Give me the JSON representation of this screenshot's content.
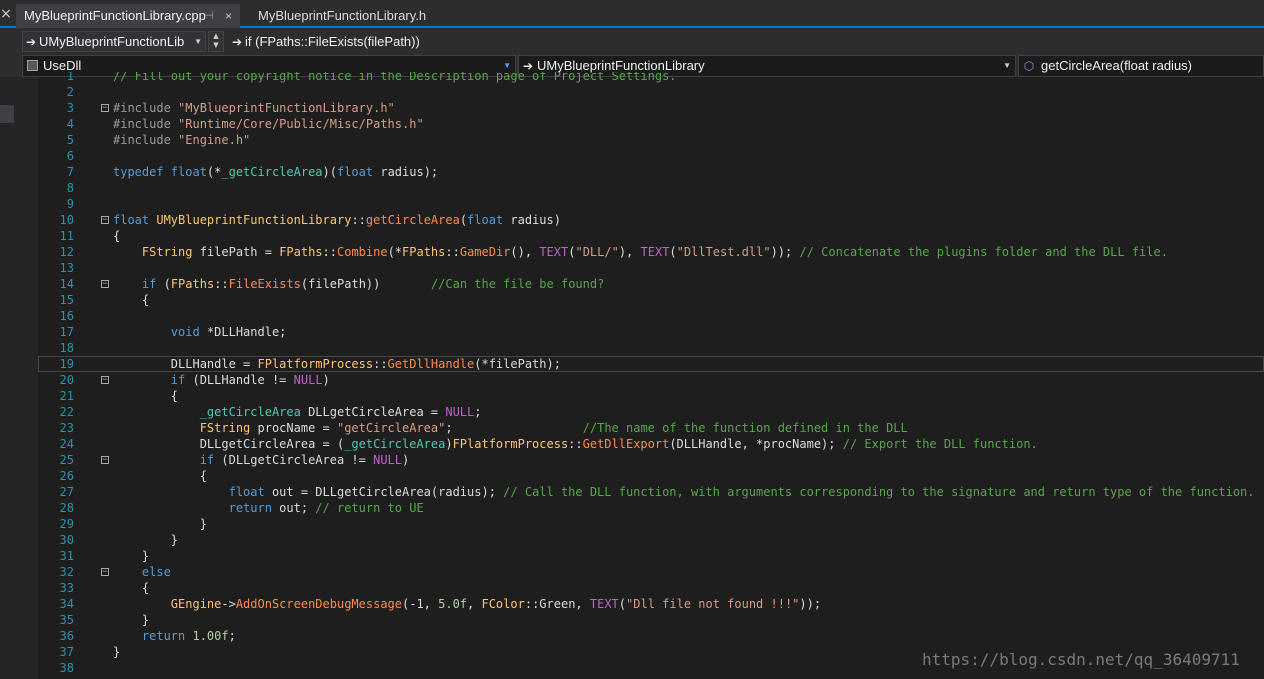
{
  "tabs": [
    {
      "label": "MyBlueprintFunctionLibrary.cpp",
      "active": true,
      "pin": "⊣",
      "close": "×"
    },
    {
      "label": "MyBlueprintFunctionLibrary.h",
      "active": false
    }
  ],
  "nav": {
    "class_combo": "UMyBlueprintFunctionLib",
    "scope_combo": "if (FPaths::FileExists(filePath))",
    "project_combo": "UseDll",
    "type_combo": "UMyBlueprintFunctionLibrary",
    "member_combo": "getCircleArea(float radius)"
  },
  "code": {
    "lines": [
      {
        "n": "1",
        "toks": [
          [
            "cm",
            "// Fill out your copyright notice in the Description page of Project Settings."
          ]
        ]
      },
      {
        "n": "2",
        "toks": []
      },
      {
        "n": "3",
        "fold": "⊟",
        "toks": [
          [
            "pp",
            "#include "
          ],
          [
            "st",
            "\"MyBlueprintFunctionLibrary.h\""
          ]
        ]
      },
      {
        "n": "4",
        "toks": [
          [
            "pp",
            "#include "
          ],
          [
            "st",
            "\"Runtime/Core/Public/Misc/Paths.h\""
          ]
        ]
      },
      {
        "n": "5",
        "toks": [
          [
            "pp",
            "#include "
          ],
          [
            "st",
            "\"Engine.h\""
          ]
        ]
      },
      {
        "n": "6",
        "toks": []
      },
      {
        "n": "7",
        "toks": [
          [
            "kw",
            "typedef "
          ],
          [
            "kw",
            "float"
          ],
          [
            "tx",
            "(*"
          ],
          [
            "ty",
            "_getCircleArea"
          ],
          [
            "tx",
            ")("
          ],
          [
            "kw",
            "float "
          ],
          [
            "tx",
            "radius);"
          ]
        ]
      },
      {
        "n": "8",
        "toks": []
      },
      {
        "n": "9",
        "toks": []
      },
      {
        "n": "10",
        "fold": "⊟",
        "toks": [
          [
            "kw",
            "float "
          ],
          [
            "cl",
            "UMyBlueprintFunctionLibrary"
          ],
          [
            "tx",
            "::"
          ],
          [
            "fn",
            "getCircleArea"
          ],
          [
            "tx",
            "("
          ],
          [
            "kw",
            "float "
          ],
          [
            "tx",
            "radius)"
          ]
        ]
      },
      {
        "n": "11",
        "toks": [
          [
            "tx",
            "{"
          ]
        ]
      },
      {
        "n": "12",
        "toks": [
          [
            "tx",
            "    "
          ],
          [
            "cl",
            "FString "
          ],
          [
            "tx",
            "filePath = "
          ],
          [
            "cl",
            "FPaths"
          ],
          [
            "tx",
            "::"
          ],
          [
            "fn",
            "Combine"
          ],
          [
            "tx",
            "(*"
          ],
          [
            "cl",
            "FPaths"
          ],
          [
            "tx",
            "::"
          ],
          [
            "fn",
            "GameDir"
          ],
          [
            "tx",
            "(), "
          ],
          [
            "mac",
            "TEXT"
          ],
          [
            "tx",
            "("
          ],
          [
            "st",
            "\"DLL/\""
          ],
          [
            "tx",
            "), "
          ],
          [
            "mac",
            "TEXT"
          ],
          [
            "tx",
            "("
          ],
          [
            "st",
            "\"DllTest.dll\""
          ],
          [
            "tx",
            ")); "
          ],
          [
            "cm",
            "// Concatenate the plugins folder and the DLL file."
          ]
        ]
      },
      {
        "n": "13",
        "toks": []
      },
      {
        "n": "14",
        "fold": "⊟",
        "toks": [
          [
            "tx",
            "    "
          ],
          [
            "kw",
            "if "
          ],
          [
            "tx",
            "("
          ],
          [
            "cl",
            "FPaths"
          ],
          [
            "tx",
            "::"
          ],
          [
            "fn",
            "FileExists"
          ],
          [
            "tx",
            "(filePath))       "
          ],
          [
            "cm",
            "//Can the file be found?"
          ]
        ]
      },
      {
        "n": "15",
        "toks": [
          [
            "tx",
            "    {"
          ]
        ]
      },
      {
        "n": "16",
        "toks": []
      },
      {
        "n": "17",
        "toks": [
          [
            "tx",
            "        "
          ],
          [
            "kw",
            "void "
          ],
          [
            "tx",
            "*DLLHandle;"
          ]
        ]
      },
      {
        "n": "18",
        "toks": []
      },
      {
        "n": "19",
        "cur": true,
        "toks": [
          [
            "tx",
            "        DLLHandle = "
          ],
          [
            "cl",
            "FPlatformProcess"
          ],
          [
            "tx",
            "::"
          ],
          [
            "fn",
            "GetDllHandle"
          ],
          [
            "tx",
            "(*filePath);"
          ]
        ]
      },
      {
        "n": "20",
        "fold": "⊟",
        "toks": [
          [
            "tx",
            "        "
          ],
          [
            "kw",
            "if "
          ],
          [
            "tx",
            "(DLLHandle != "
          ],
          [
            "mac",
            "NULL"
          ],
          [
            "tx",
            ")"
          ]
        ]
      },
      {
        "n": "21",
        "toks": [
          [
            "tx",
            "        {"
          ]
        ]
      },
      {
        "n": "22",
        "toks": [
          [
            "tx",
            "            "
          ],
          [
            "ty",
            "_getCircleArea "
          ],
          [
            "tx",
            "DLLgetCircleArea = "
          ],
          [
            "mac",
            "NULL"
          ],
          [
            "tx",
            ";"
          ]
        ]
      },
      {
        "n": "23",
        "toks": [
          [
            "tx",
            "            "
          ],
          [
            "cl",
            "FString "
          ],
          [
            "tx",
            "procName = "
          ],
          [
            "st",
            "\"getCircleArea\""
          ],
          [
            "tx",
            ";                  "
          ],
          [
            "cm",
            "//The name of the function defined in the DLL"
          ]
        ]
      },
      {
        "n": "24",
        "toks": [
          [
            "tx",
            "            DLLgetCircleArea = ("
          ],
          [
            "ty",
            "_getCircleArea"
          ],
          [
            "tx",
            ")"
          ],
          [
            "cl",
            "FPlatformProcess"
          ],
          [
            "tx",
            "::"
          ],
          [
            "fn",
            "GetDllExport"
          ],
          [
            "tx",
            "(DLLHandle, *procName); "
          ],
          [
            "cm",
            "// Export the DLL function."
          ]
        ]
      },
      {
        "n": "25",
        "fold": "⊟",
        "toks": [
          [
            "tx",
            "            "
          ],
          [
            "kw",
            "if "
          ],
          [
            "tx",
            "(DLLgetCircleArea != "
          ],
          [
            "mac",
            "NULL"
          ],
          [
            "tx",
            ")"
          ]
        ]
      },
      {
        "n": "26",
        "toks": [
          [
            "tx",
            "            {"
          ]
        ]
      },
      {
        "n": "27",
        "toks": [
          [
            "tx",
            "                "
          ],
          [
            "kw",
            "float "
          ],
          [
            "tx",
            "out = DLLgetCircleArea(radius); "
          ],
          [
            "cm",
            "// Call the DLL function, with arguments corresponding to the signature and return type of the function."
          ]
        ]
      },
      {
        "n": "28",
        "toks": [
          [
            "tx",
            "                "
          ],
          [
            "kw",
            "return "
          ],
          [
            "tx",
            "out; "
          ],
          [
            "cm",
            "// return to UE"
          ]
        ]
      },
      {
        "n": "29",
        "toks": [
          [
            "tx",
            "            }"
          ]
        ]
      },
      {
        "n": "30",
        "toks": [
          [
            "tx",
            "        }"
          ]
        ]
      },
      {
        "n": "31",
        "toks": [
          [
            "tx",
            "    }"
          ]
        ]
      },
      {
        "n": "32",
        "fold": "⊟",
        "toks": [
          [
            "tx",
            "    "
          ],
          [
            "kw",
            "else"
          ]
        ]
      },
      {
        "n": "33",
        "toks": [
          [
            "tx",
            "    {"
          ]
        ]
      },
      {
        "n": "34",
        "toks": [
          [
            "tx",
            "        "
          ],
          [
            "cl",
            "GEngine"
          ],
          [
            "tx",
            "->"
          ],
          [
            "fn",
            "AddOnScreenDebugMessage"
          ],
          [
            "tx",
            "(-1, "
          ],
          [
            "num",
            "5.0f"
          ],
          [
            "tx",
            ", "
          ],
          [
            "cl",
            "FColor"
          ],
          [
            "tx",
            "::Green, "
          ],
          [
            "mac",
            "TEXT"
          ],
          [
            "tx",
            "("
          ],
          [
            "st",
            "\"Dll file not found !!!\""
          ],
          [
            "tx",
            "));"
          ]
        ]
      },
      {
        "n": "35",
        "toks": [
          [
            "tx",
            "    }"
          ]
        ]
      },
      {
        "n": "36",
        "toks": [
          [
            "tx",
            "    "
          ],
          [
            "kw",
            "return "
          ],
          [
            "num",
            "1.00f"
          ],
          [
            "tx",
            ";"
          ]
        ]
      },
      {
        "n": "37",
        "toks": [
          [
            "tx",
            "}"
          ]
        ]
      },
      {
        "n": "38",
        "toks": []
      }
    ]
  },
  "watermark": "https://blog.csdn.net/qq_36409711"
}
